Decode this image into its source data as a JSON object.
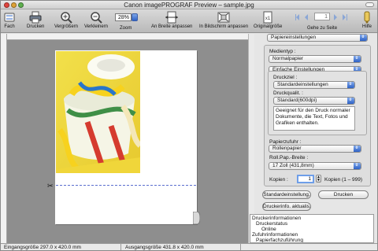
{
  "window": {
    "title": "Canon imagePROGRAF Preview – sample.jpg"
  },
  "toolbar": {
    "items": [
      {
        "label": "Fach",
        "icon": "tray-icon"
      },
      {
        "label": "Drucken",
        "icon": "printer-icon"
      },
      {
        "label": "Vergrößern",
        "icon": "zoom-in-icon"
      },
      {
        "label": "Verkleinern",
        "icon": "zoom-out-icon"
      },
      {
        "label": "Zoom",
        "icon": "zoom-select"
      },
      {
        "label": "An Breite anpassen",
        "icon": "fit-width-icon"
      },
      {
        "label": "In Bildschirm anpassen",
        "icon": "fit-screen-icon"
      },
      {
        "label": "Originalgröße",
        "icon": "original-size-icon"
      },
      {
        "label": "Gehe zu Seite",
        "icon": "page-nav-icon"
      },
      {
        "label": "Hilfe",
        "icon": "help-icon"
      }
    ],
    "zoom_value": "28%",
    "page_number": "1"
  },
  "status_bar": {
    "input_size": "Eingangsgröße 297.0 x 420.0 mm",
    "output_size": "Ausgangsgröße 431.8 x 420.0 mm"
  },
  "panel": {
    "settings_popup": "Papiereinstellungen",
    "media_type_label": "Medientyp :",
    "media_type_value": "Normalpapier",
    "mode_popup": "Einfache Einstellungen",
    "print_target_label": "Druckziel :",
    "print_target_value": "Standardeinstellungen",
    "print_quality_label": "Druckqualit. :",
    "print_quality_value": "Standard(600dpi)",
    "description": "Geeignet für den Druck normaler Dokumente, die Text, Fotos und Grafiken enthalten.",
    "paper_source_label": "Papierzufuhr :",
    "paper_source_value": "Rollenpapier",
    "roll_width_label": "Roll.Pap.-Breite :",
    "roll_width_value": "17 Zoll (431,8mm)",
    "copies_label": "Kopien :",
    "copies_value": "1",
    "copies_range": "Kopien (1 – 999)",
    "defaults_button": "Standardeinstellung.",
    "print_button": "Drucken",
    "update_info_button": "Druckerinfo. aktualis."
  },
  "info_list": [
    "Druckerinformationen",
    "Druckerstatus",
    "Online",
    "Zufuhrinformationen",
    "Papierfachzuführung"
  ],
  "colors": {
    "accent_blue": "#2d62c6",
    "canvas_gray": "#8e8e8e",
    "cut_line": "#5b6fcf"
  }
}
